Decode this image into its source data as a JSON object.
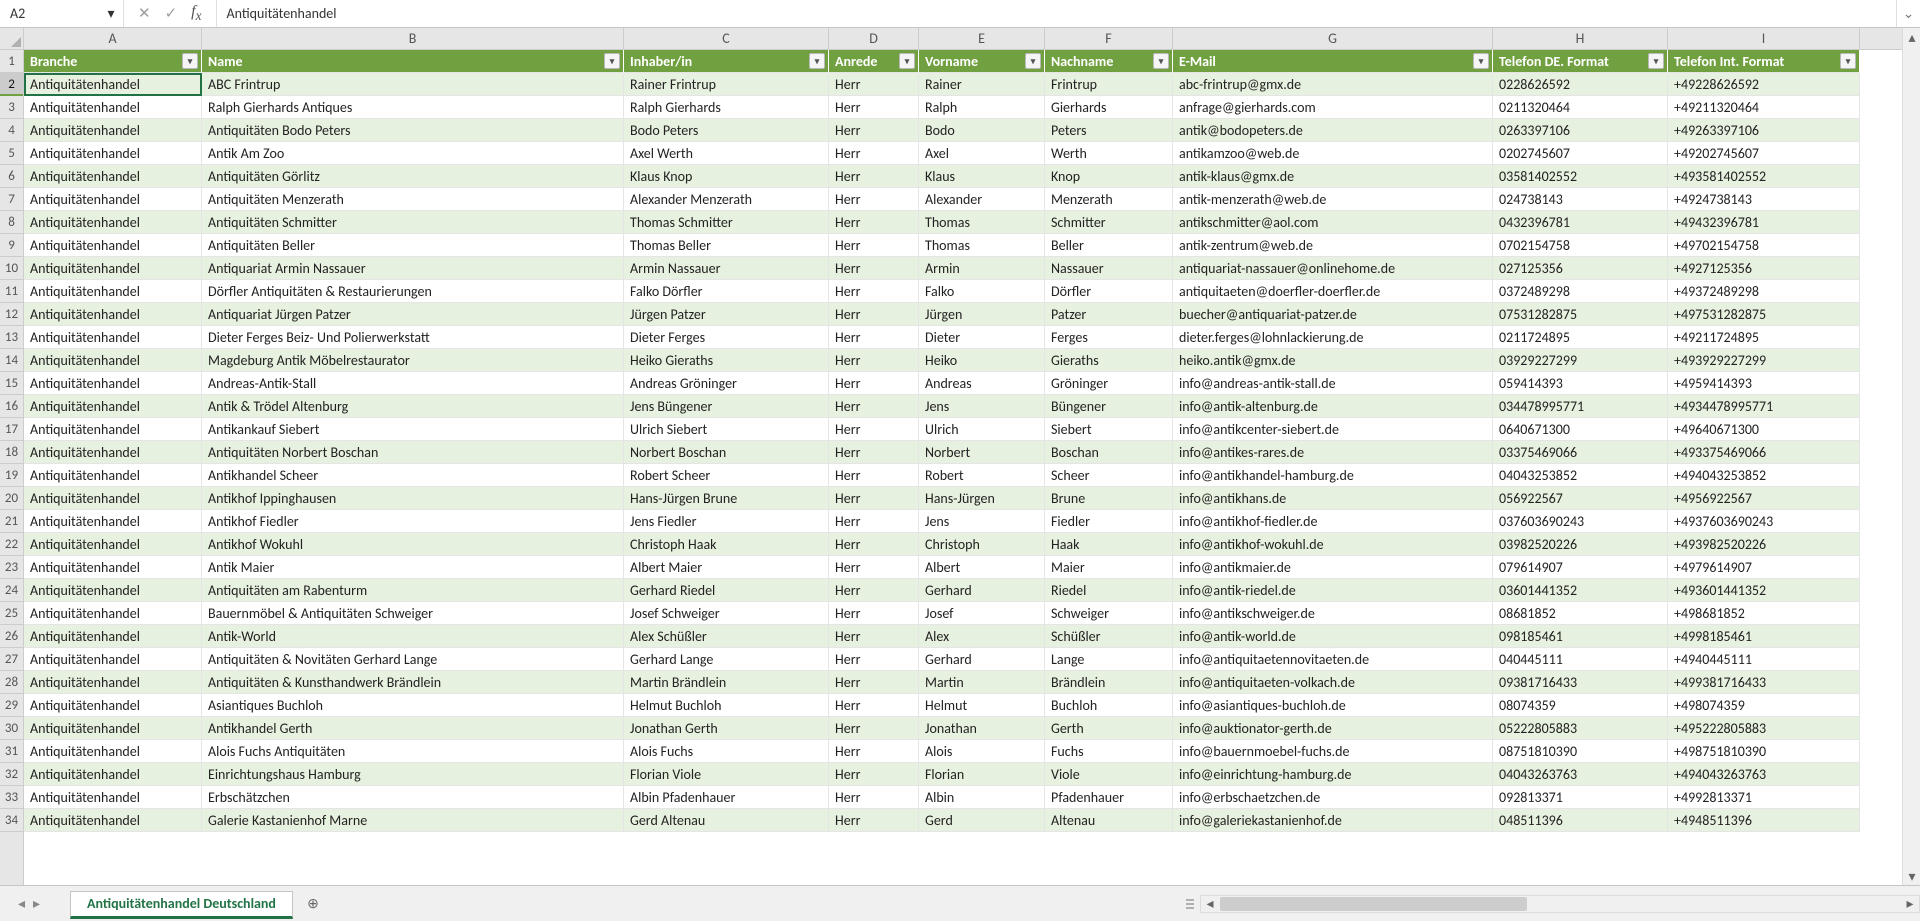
{
  "nameBox": "A2",
  "formulaValue": "Antiquitätenhandel",
  "sheetName": "Antiquitätenhandel Deutschland",
  "columnLetters": [
    "A",
    "B",
    "C",
    "D",
    "E",
    "F",
    "G",
    "H",
    "I"
  ],
  "headers": [
    "Branche",
    "Name",
    "Inhaber/in",
    "Anrede",
    "Vorname",
    "Nachname",
    "E-Mail",
    "Telefon DE. Format",
    "Telefon Int. Format"
  ],
  "rowStart": 1,
  "rowEnd": 34,
  "selectedCell": "A2",
  "chart_data": null,
  "rows": [
    [
      "Antiquitätenhandel",
      "ABC Frintrup",
      "Rainer Frintrup",
      "Herr",
      "Rainer",
      "Frintrup",
      "abc-frintrup@gmx.de",
      "0228626592",
      "+49228626592"
    ],
    [
      "Antiquitätenhandel",
      "Ralph Gierhards Antiques",
      "Ralph Gierhards",
      "Herr",
      "Ralph",
      "Gierhards",
      "anfrage@gierhards.com",
      "0211320464",
      "+49211320464"
    ],
    [
      "Antiquitätenhandel",
      "Antiquitäten Bodo Peters",
      "Bodo Peters",
      "Herr",
      "Bodo",
      "Peters",
      "antik@bodopeters.de",
      "0263397106",
      "+49263397106"
    ],
    [
      "Antiquitätenhandel",
      "Antik Am Zoo",
      "Axel Werth",
      "Herr",
      "Axel",
      "Werth",
      "antikamzoo@web.de",
      "0202745607",
      "+49202745607"
    ],
    [
      "Antiquitätenhandel",
      "Antiquitäten Görlitz",
      "Klaus Knop",
      "Herr",
      "Klaus",
      "Knop",
      "antik-klaus@gmx.de",
      "03581402552",
      "+493581402552"
    ],
    [
      "Antiquitätenhandel",
      "Antiquitäten Menzerath",
      "Alexander Menzerath",
      "Herr",
      "Alexander",
      "Menzerath",
      "antik-menzerath@web.de",
      "024738143",
      "+4924738143"
    ],
    [
      "Antiquitätenhandel",
      "Antiquitäten Schmitter",
      "Thomas Schmitter",
      "Herr",
      "Thomas",
      "Schmitter",
      "antikschmitter@aol.com",
      "0432396781",
      "+49432396781"
    ],
    [
      "Antiquitätenhandel",
      "Antiquitäten Beller",
      "Thomas Beller",
      "Herr",
      "Thomas",
      "Beller",
      "antik-zentrum@web.de",
      "0702154758",
      "+49702154758"
    ],
    [
      "Antiquitätenhandel",
      "Antiquariat Armin Nassauer",
      "Armin Nassauer",
      "Herr",
      "Armin",
      "Nassauer",
      "antiquariat-nassauer@onlinehome.de",
      "027125356",
      "+4927125356"
    ],
    [
      "Antiquitätenhandel",
      "Dörfler Antiquitäten & Restaurierungen",
      "Falko Dörfler",
      "Herr",
      "Falko",
      "Dörfler",
      "antiquitaeten@doerfler-doerfler.de",
      "0372489298",
      "+49372489298"
    ],
    [
      "Antiquitätenhandel",
      "Antiquariat Jürgen Patzer",
      "Jürgen Patzer",
      "Herr",
      "Jürgen",
      "Patzer",
      "buecher@antiquariat-patzer.de",
      "07531282875",
      "+497531282875"
    ],
    [
      "Antiquitätenhandel",
      "Dieter Ferges Beiz- Und Polierwerkstatt",
      "Dieter Ferges",
      "Herr",
      "Dieter",
      "Ferges",
      "dieter.ferges@lohnlackierung.de",
      "0211724895",
      "+49211724895"
    ],
    [
      "Antiquitätenhandel",
      "Magdeburg Antik Möbelrestaurator",
      "Heiko Gieraths",
      "Herr",
      "Heiko",
      "Gieraths",
      "heiko.antik@gmx.de",
      "03929227299",
      "+493929227299"
    ],
    [
      "Antiquitätenhandel",
      "Andreas-Antik-Stall",
      "Andreas Gröninger",
      "Herr",
      "Andreas",
      "Gröninger",
      "info@andreas-antik-stall.de",
      "059414393",
      "+4959414393"
    ],
    [
      "Antiquitätenhandel",
      "Antik & Trödel Altenburg",
      "Jens Büngener",
      "Herr",
      "Jens",
      "Büngener",
      "info@antik-altenburg.de",
      "034478995771",
      "+4934478995771"
    ],
    [
      "Antiquitätenhandel",
      "Antikankauf Siebert",
      "Ulrich Siebert",
      "Herr",
      "Ulrich",
      "Siebert",
      "info@antikcenter-siebert.de",
      "0640671300",
      "+49640671300"
    ],
    [
      "Antiquitätenhandel",
      "Antiquitäten Norbert Boschan",
      "Norbert Boschan",
      "Herr",
      "Norbert",
      "Boschan",
      "info@antikes-rares.de",
      "03375469066",
      "+493375469066"
    ],
    [
      "Antiquitätenhandel",
      "Antikhandel Scheer",
      "Robert Scheer",
      "Herr",
      "Robert",
      "Scheer",
      "info@antikhandel-hamburg.de",
      "04043253852",
      "+494043253852"
    ],
    [
      "Antiquitätenhandel",
      "Antikhof Ippinghausen",
      "Hans-Jürgen Brune",
      "Herr",
      "Hans-Jürgen",
      "Brune",
      "info@antikhans.de",
      "056922567",
      "+4956922567"
    ],
    [
      "Antiquitätenhandel",
      "Antikhof Fiedler",
      "Jens Fiedler",
      "Herr",
      "Jens",
      "Fiedler",
      "info@antikhof-fiedler.de",
      "037603690243",
      "+4937603690243"
    ],
    [
      "Antiquitätenhandel",
      "Antikhof Wokuhl",
      "Christoph Haak",
      "Herr",
      "Christoph",
      "Haak",
      "info@antikhof-wokuhl.de",
      "03982520226",
      "+493982520226"
    ],
    [
      "Antiquitätenhandel",
      "Antik Maier",
      "Albert Maier",
      "Herr",
      "Albert",
      "Maier",
      "info@antikmaier.de",
      "079614907",
      "+4979614907"
    ],
    [
      "Antiquitätenhandel",
      "Antiquitäten am Rabenturm",
      "Gerhard Riedel",
      "Herr",
      "Gerhard",
      "Riedel",
      "info@antik-riedel.de",
      "03601441352",
      "+493601441352"
    ],
    [
      "Antiquitätenhandel",
      "Bauernmöbel & Antiquitäten Schweiger",
      "Josef Schweiger",
      "Herr",
      "Josef",
      "Schweiger",
      "info@antikschweiger.de",
      "08681852",
      "+498681852"
    ],
    [
      "Antiquitätenhandel",
      "Antik-World",
      "Alex Schüßler",
      "Herr",
      "Alex",
      "Schüßler",
      "info@antik-world.de",
      "098185461",
      "+4998185461"
    ],
    [
      "Antiquitätenhandel",
      "Antiquitäten & Novitäten Gerhard Lange",
      "Gerhard Lange",
      "Herr",
      "Gerhard",
      "Lange",
      "info@antiquitaetennovitaeten.de",
      "040445111",
      "+4940445111"
    ],
    [
      "Antiquitätenhandel",
      "Antiquitäten & Kunsthandwerk Brändlein",
      "Martin Brändlein",
      "Herr",
      "Martin",
      "Brändlein",
      "info@antiquitaeten-volkach.de",
      "09381716433",
      "+499381716433"
    ],
    [
      "Antiquitätenhandel",
      "Asiantiques Buchloh",
      "Helmut Buchloh",
      "Herr",
      "Helmut",
      "Buchloh",
      "info@asiantiques-buchloh.de",
      "08074359",
      "+498074359"
    ],
    [
      "Antiquitätenhandel",
      "Antikhandel Gerth",
      "Jonathan Gerth",
      "Herr",
      "Jonathan",
      "Gerth",
      "info@auktionator-gerth.de",
      "05222805883",
      "+495222805883"
    ],
    [
      "Antiquitätenhandel",
      "Alois Fuchs Antiquitäten",
      "Alois Fuchs",
      "Herr",
      "Alois",
      "Fuchs",
      "info@bauernmoebel-fuchs.de",
      "08751810390",
      "+498751810390"
    ],
    [
      "Antiquitätenhandel",
      "Einrichtungshaus Hamburg",
      "Florian Viole",
      "Herr",
      "Florian",
      "Viole",
      "info@einrichtung-hamburg.de",
      "04043263763",
      "+494043263763"
    ],
    [
      "Antiquitätenhandel",
      "Erbschätzchen",
      "Albin Pfadenhauer",
      "Herr",
      "Albin",
      "Pfadenhauer",
      "info@erbschaetzchen.de",
      "092813371",
      "+4992813371"
    ],
    [
      "Antiquitätenhandel",
      "Galerie Kastanienhof Marne",
      "Gerd Altenau",
      "Herr",
      "Gerd",
      "Altenau",
      "info@galeriekastanienhof.de",
      "048511396",
      "+4948511396"
    ]
  ]
}
